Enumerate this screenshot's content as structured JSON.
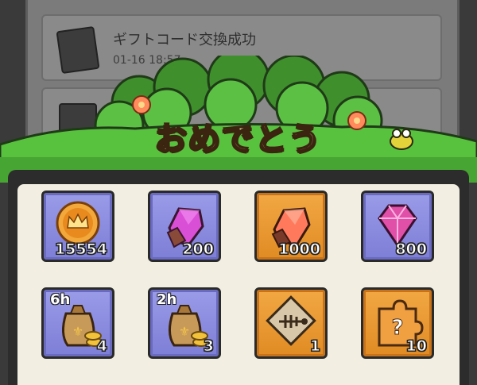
{
  "background_mail": {
    "item1": {
      "title": "ギフトコード交換成功",
      "time": "01-16 18:57"
    }
  },
  "banner": {
    "title": "おめでとう"
  },
  "rewards": [
    {
      "name": "gold-crown-coin",
      "qty": "15554",
      "frame": "purple"
    },
    {
      "name": "pink-crystal",
      "qty": "200",
      "frame": "purple"
    },
    {
      "name": "orange-crystal",
      "qty": "1000",
      "frame": "orange"
    },
    {
      "name": "pink-gem",
      "qty": "800",
      "frame": "purple"
    },
    {
      "name": "gold-bag-6h",
      "duration": "6h",
      "qty": "4",
      "frame": "purple"
    },
    {
      "name": "gold-bag-2h",
      "duration": "2h",
      "qty": "3",
      "frame": "purple"
    },
    {
      "name": "fish-bone-tile",
      "qty": "1",
      "frame": "orange"
    },
    {
      "name": "mystery-puzzle",
      "qty": "10",
      "frame": "orange"
    }
  ],
  "colors": {
    "purple_frame": "#8c8de0",
    "orange_frame": "#eb9a32",
    "bush_green": "#4fb63a",
    "title_yellow": "#fff3b0"
  }
}
